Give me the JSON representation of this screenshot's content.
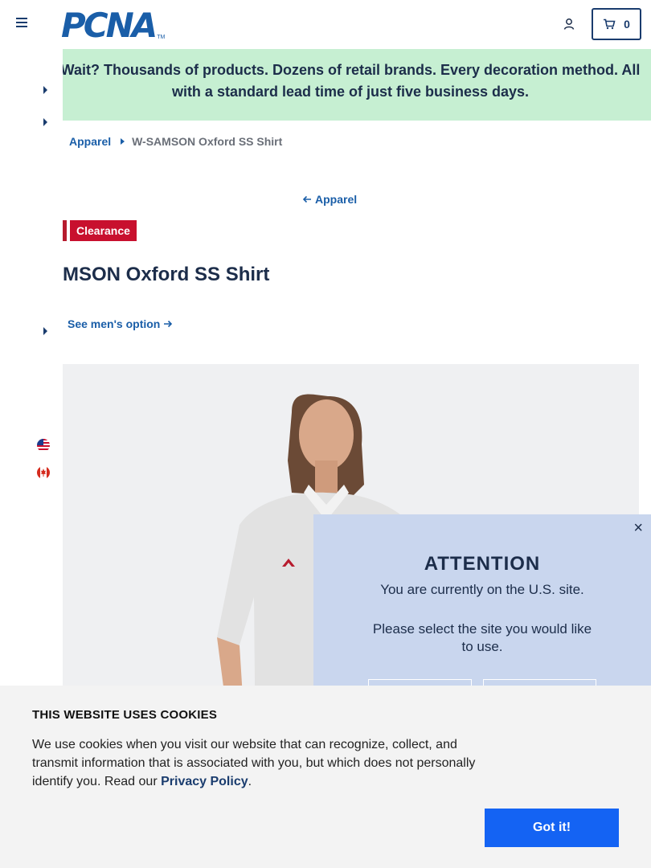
{
  "header": {
    "logo_text": "PCNA",
    "logo_tm": "TM",
    "cart_count": "0"
  },
  "banner": {
    "text": "Wait? Thousands of products. Dozens of retail brands. Every decoration method. All with a standard lead time of just five business days."
  },
  "breadcrumb": {
    "parent": "Apparel",
    "current": "W-SAMSON Oxford SS Shirt"
  },
  "back_link": "Apparel",
  "badge": "Clearance",
  "product": {
    "title": "MSON Oxford SS Shirt",
    "mens_link": "See men's option"
  },
  "modal": {
    "title": "ATTENTION",
    "line1": "You are currently on the U.S. site.",
    "line2": "Please select the site you would like to use.",
    "close": "×"
  },
  "cookie": {
    "title": "THIS WEBSITE USES COOKIES",
    "text_before": "We use cookies when you visit our website that can recognize, collect, and transmit information that is associated with you, but which does not personally identify you. Read our ",
    "link": "Privacy Policy",
    "text_after": ".",
    "button": "Got it!"
  },
  "colors": {
    "brand_blue": "#1a5ea8",
    "navy": "#1c2d4a",
    "banner_bg": "#c6efd2",
    "clearance_red": "#c8102e",
    "modal_bg": "#c9d6ee",
    "cookie_button": "#1463f3"
  },
  "icons": [
    "hamburger-icon",
    "user-icon",
    "cart-icon",
    "us-flag-icon",
    "canada-flag-icon",
    "arrow-left-icon",
    "arrow-right-icon",
    "caret-right-icon"
  ]
}
